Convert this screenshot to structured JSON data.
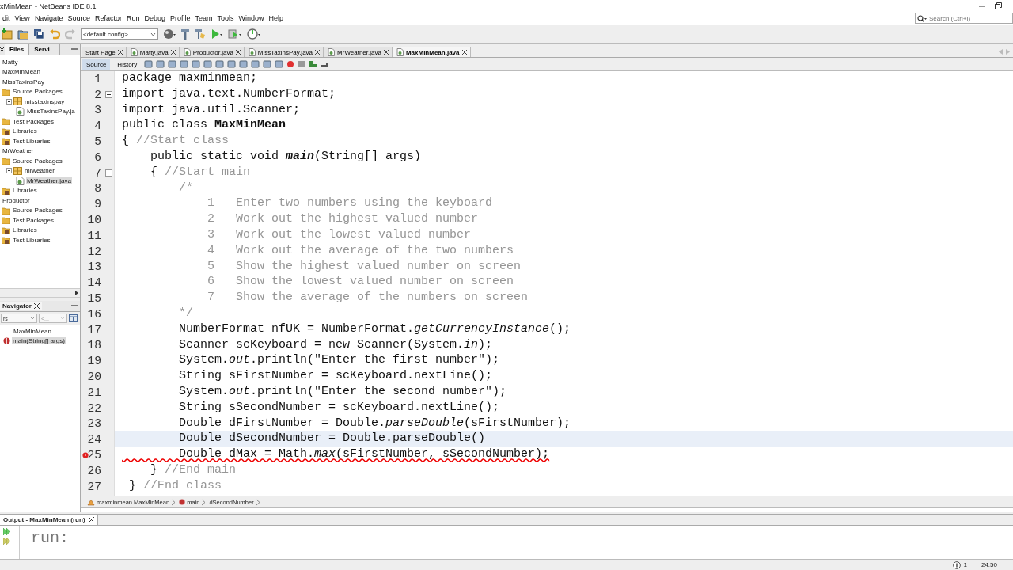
{
  "window": {
    "title": "xMinMean - NetBeans IDE 8.1"
  },
  "menu": [
    "dit",
    "View",
    "Navigate",
    "Source",
    "Refactor",
    "Run",
    "Debug",
    "Profile",
    "Team",
    "Tools",
    "Window",
    "Help"
  ],
  "toolbar": {
    "config": "<default config>"
  },
  "search": {
    "placeholder": "Search (Ctrl+I)"
  },
  "projects_panel": {
    "tabs": [
      {
        "label": "Files",
        "selected": true
      },
      {
        "label": "Servi...",
        "selected": false
      }
    ],
    "tree": [
      {
        "label": "Matty",
        "kind": "project"
      },
      {
        "label": "MaxMinMean",
        "kind": "project"
      },
      {
        "label": "MissTaxinsPay",
        "kind": "project",
        "children": [
          {
            "label": "Source Packages",
            "kind": "folder",
            "children": [
              {
                "label": "misstaxinspay",
                "kind": "package",
                "expanded": true,
                "children": [
                  {
                    "label": "MissTaxinsPay.ja",
                    "kind": "file",
                    "selected": false
                  }
                ]
              }
            ]
          },
          {
            "label": "Test Packages",
            "kind": "folder"
          },
          {
            "label": "Libraries",
            "kind": "library"
          },
          {
            "label": "Test Libraries",
            "kind": "library"
          }
        ]
      },
      {
        "label": "MrWeather",
        "kind": "project",
        "children": [
          {
            "label": "Source Packages",
            "kind": "folder",
            "children": [
              {
                "label": "mrweather",
                "kind": "package",
                "expanded": true,
                "children": [
                  {
                    "label": "MrWeather.java",
                    "kind": "file",
                    "selected": true
                  }
                ]
              }
            ]
          },
          {
            "label": "Libraries",
            "kind": "library"
          }
        ]
      },
      {
        "label": "Productor",
        "kind": "project",
        "children": [
          {
            "label": "Source Packages",
            "kind": "folder"
          },
          {
            "label": "Test Packages",
            "kind": "folder"
          },
          {
            "label": "Libraries",
            "kind": "library"
          },
          {
            "label": "Test Libraries",
            "kind": "library"
          }
        ]
      }
    ]
  },
  "navigator": {
    "title": "Navigator",
    "filter": "rs",
    "combo": "<...",
    "tree": [
      {
        "label": "MaxMinMean",
        "children": [
          {
            "label": "main(String[] args)",
            "selected": true
          }
        ]
      }
    ]
  },
  "editor_tabs": [
    {
      "label": "Start Page",
      "kind": "page",
      "selected": false
    },
    {
      "label": "Matty.java",
      "kind": "java",
      "selected": false
    },
    {
      "label": "Productor.java",
      "kind": "java",
      "selected": false
    },
    {
      "label": "MissTaxinsPay.java",
      "kind": "java",
      "selected": false
    },
    {
      "label": "MrWeather.java",
      "kind": "java",
      "selected": false
    },
    {
      "label": "MaxMinMean.java",
      "kind": "java",
      "selected": true
    }
  ],
  "editor_modes": [
    {
      "label": "Source",
      "selected": true
    },
    {
      "label": "History",
      "selected": false
    }
  ],
  "code": [
    {
      "number": "1",
      "tokens": [
        {
          "text": "package maxminmean;",
          "kind": "code"
        }
      ]
    },
    {
      "number": "2",
      "fold": true,
      "tokens": [
        {
          "text": "import java.text.NumberFormat;",
          "kind": "code"
        }
      ]
    },
    {
      "number": "3",
      "tokens": [
        {
          "text": "import java.util.Scanner;",
          "kind": "code"
        }
      ]
    },
    {
      "number": "4",
      "tokens": [
        {
          "text": "public class ",
          "kind": "code"
        },
        {
          "text": "MaxMinMean",
          "kind": "bold"
        }
      ]
    },
    {
      "number": "5",
      "tokens": [
        {
          "text": "{ ",
          "kind": "code"
        },
        {
          "text": "//Start class",
          "kind": "comment"
        }
      ]
    },
    {
      "number": "6",
      "tokens": [
        {
          "text": "    public static void ",
          "kind": "code"
        },
        {
          "text": "main",
          "kind": "bolditalic"
        },
        {
          "text": "(String[] args)",
          "kind": "code"
        }
      ]
    },
    {
      "number": "7",
      "fold": true,
      "tokens": [
        {
          "text": "    { ",
          "kind": "code"
        },
        {
          "text": "//Start main",
          "kind": "comment"
        }
      ]
    },
    {
      "number": "8",
      "tokens": [
        {
          "text": "        /*",
          "kind": "comment"
        }
      ]
    },
    {
      "number": "9",
      "tokens": [
        {
          "text": "            1   Enter two numbers using the keyboard",
          "kind": "comment"
        }
      ]
    },
    {
      "number": "10",
      "tokens": [
        {
          "text": "            2   Work out the highest valued number",
          "kind": "comment"
        }
      ]
    },
    {
      "number": "11",
      "tokens": [
        {
          "text": "            3   Work out the lowest valued number",
          "kind": "comment"
        }
      ]
    },
    {
      "number": "12",
      "tokens": [
        {
          "text": "            4   Work out the average of the two numbers",
          "kind": "comment"
        }
      ]
    },
    {
      "number": "13",
      "tokens": [
        {
          "text": "            5   Show the highest valued number on screen",
          "kind": "comment"
        }
      ]
    },
    {
      "number": "14",
      "tokens": [
        {
          "text": "            6   Show the lowest valued number on screen",
          "kind": "comment"
        }
      ]
    },
    {
      "number": "15",
      "tokens": [
        {
          "text": "            7   Show the average of the numbers on screen",
          "kind": "comment"
        }
      ]
    },
    {
      "number": "16",
      "tokens": [
        {
          "text": "        */",
          "kind": "comment"
        }
      ]
    },
    {
      "number": "17",
      "tokens": [
        {
          "text": "        NumberFormat nfUK = NumberFormat.",
          "kind": "code"
        },
        {
          "text": "getCurrencyInstance",
          "kind": "italic"
        },
        {
          "text": "();",
          "kind": "code"
        }
      ]
    },
    {
      "number": "18",
      "tokens": [
        {
          "text": "        Scanner scKeyboard = new Scanner(System.",
          "kind": "code"
        },
        {
          "text": "in",
          "kind": "italic"
        },
        {
          "text": ");",
          "kind": "code"
        }
      ]
    },
    {
      "number": "19",
      "tokens": [
        {
          "text": "        System.",
          "kind": "code"
        },
        {
          "text": "out",
          "kind": "italic"
        },
        {
          "text": ".println(\"Enter the first number\");",
          "kind": "code"
        }
      ]
    },
    {
      "number": "20",
      "tokens": [
        {
          "text": "        String sFirstNumber = scKeyboard.nextLine();",
          "kind": "code"
        }
      ]
    },
    {
      "number": "21",
      "tokens": [
        {
          "text": "        System.",
          "kind": "code"
        },
        {
          "text": "out",
          "kind": "italic"
        },
        {
          "text": ".println(\"Enter the second number\");",
          "kind": "code"
        }
      ]
    },
    {
      "number": "22",
      "tokens": [
        {
          "text": "        String sSecondNumber = scKeyboard.nextLine();",
          "kind": "code"
        }
      ]
    },
    {
      "number": "23",
      "tokens": [
        {
          "text": "        Double dFirstNumber = Double.",
          "kind": "code"
        },
        {
          "text": "parseDouble",
          "kind": "italic"
        },
        {
          "text": "(sFirstNumber);",
          "kind": "code"
        }
      ]
    },
    {
      "number": "24",
      "current": true,
      "tokens": [
        {
          "text": "        Double dSecondNumber = Double.parseDouble()",
          "kind": "code"
        }
      ]
    },
    {
      "number": "25",
      "error": true,
      "tokens": [
        {
          "text": "        Double dMax = Math.",
          "kind": "code"
        },
        {
          "text": "max",
          "kind": "italic"
        },
        {
          "text": "(sFirstNumber, sSecondNumber);",
          "kind": "code"
        }
      ]
    },
    {
      "number": "26",
      "tokens": [
        {
          "text": "    } ",
          "kind": "code"
        },
        {
          "text": "//End main",
          "kind": "comment"
        }
      ]
    },
    {
      "number": "27",
      "tokens": [
        {
          "text": " } ",
          "kind": "code"
        },
        {
          "text": "//End class",
          "kind": "comment"
        }
      ]
    }
  ],
  "breadcrumb": [
    {
      "label": "maxminmean.MaxMinMean",
      "kind": "class"
    },
    {
      "label": "main",
      "kind": "method"
    },
    {
      "label": "dSecondNumber",
      "kind": "field"
    }
  ],
  "output": {
    "title": "Output - MaxMinMean (run)",
    "text": "run:"
  },
  "status_bar": {
    "notifications": "1",
    "position": "24:50"
  }
}
